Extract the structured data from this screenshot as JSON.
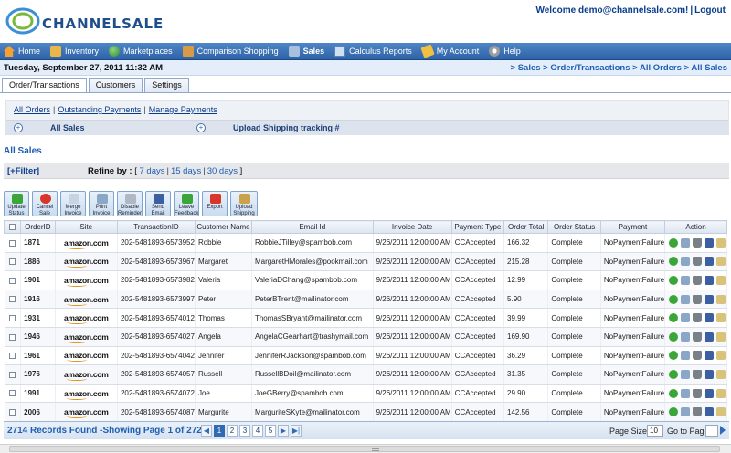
{
  "header": {
    "logo_text": "CHANNELSALE",
    "welcome": "Welcome demo@channelsale.com!",
    "separator": "|",
    "logout": "Logout"
  },
  "nav": {
    "items": [
      {
        "label": "Home",
        "icon": "home-icon"
      },
      {
        "label": "Inventory",
        "icon": "inventory-icon"
      },
      {
        "label": "Marketplaces",
        "icon": "globe-icon"
      },
      {
        "label": "Comparison Shopping",
        "icon": "folder-icon"
      },
      {
        "label": "Sales",
        "icon": "sales-icon"
      },
      {
        "label": "Calculus Reports",
        "icon": "chart-icon"
      },
      {
        "label": "My Account",
        "icon": "key-icon"
      },
      {
        "label": "Help",
        "icon": "help-icon"
      }
    ]
  },
  "datebar": {
    "date": "Tuesday, September 27, 2011 11:32 AM",
    "crumbs": [
      "Sales",
      "Order/Transactions",
      "All Orders",
      "All Sales"
    ]
  },
  "tabs": [
    "Order/Transactions",
    "Customers",
    "Settings"
  ],
  "subpanel": {
    "links": [
      "All Orders",
      "Outstanding Payments",
      "Manage Payments"
    ],
    "left_label": "All Sales",
    "right_label": "Upload Shipping tracking #"
  },
  "section_title": "All Sales",
  "filter": {
    "link": "[+Filter]",
    "refine_label": "Refine by :",
    "open_bracket": "[",
    "close_bracket": "]",
    "options": [
      "7 days",
      "15 days",
      "30 days"
    ]
  },
  "toolbar": [
    {
      "label": "Update Status",
      "icon": "update-status-icon",
      "color": "#3aa63a"
    },
    {
      "label": "Cancel Sale",
      "icon": "cancel-icon",
      "color": "#d9362b"
    },
    {
      "label": "Merge Invoice",
      "icon": "merge-icon",
      "color": "#c8d4e4"
    },
    {
      "label": "Print Invoice",
      "icon": "print-icon",
      "color": "#8aa7c7"
    },
    {
      "label": "Disable Reminder",
      "icon": "disable-reminder-icon",
      "color": "#b0b8c4"
    },
    {
      "label": "Send Email",
      "icon": "email-icon",
      "color": "#3b5fa0"
    },
    {
      "label": "Leave Feedback",
      "icon": "feedback-icon",
      "color": "#3aa63a"
    },
    {
      "label": "Export",
      "icon": "export-icon",
      "color": "#d9362b"
    },
    {
      "label": "Upload Shipping",
      "icon": "upload-shipping-icon",
      "color": "#c9a24a"
    }
  ],
  "table": {
    "columns": [
      "OrderID",
      "Site",
      "TransactionID",
      "Customer Name",
      "Email Id",
      "Invoice Date",
      "Payment Type",
      "Order Total",
      "Order Status",
      "Payment",
      "Action"
    ],
    "rows": [
      {
        "id": "1871",
        "site": "amazon.com",
        "txn": "202-5481893-6573952",
        "name": "Robbie",
        "email": "RobbieJTilley@spambob.com",
        "date": "9/26/2011 12:00:00 AM",
        "ptype": "CCAccepted",
        "total": "166.32",
        "status": "Complete",
        "payment": "NoPaymentFailure"
      },
      {
        "id": "1886",
        "site": "amazon.com",
        "txn": "202-5481893-6573967",
        "name": "Margaret",
        "email": "MargaretHMorales@pookmail.com",
        "date": "9/26/2011 12:00:00 AM",
        "ptype": "CCAccepted",
        "total": "215.28",
        "status": "Complete",
        "payment": "NoPaymentFailure"
      },
      {
        "id": "1901",
        "site": "amazon.com",
        "txn": "202-5481893-6573982",
        "name": "Valeria",
        "email": "ValeriaDChang@spambob.com",
        "date": "9/26/2011 12:00:00 AM",
        "ptype": "CCAccepted",
        "total": "12.99",
        "status": "Complete",
        "payment": "NoPaymentFailure"
      },
      {
        "id": "1916",
        "site": "amazon.com",
        "txn": "202-5481893-6573997",
        "name": "Peter",
        "email": "PeterBTrent@mailinator.com",
        "date": "9/26/2011 12:00:00 AM",
        "ptype": "CCAccepted",
        "total": "5.90",
        "status": "Complete",
        "payment": "NoPaymentFailure"
      },
      {
        "id": "1931",
        "site": "amazon.com",
        "txn": "202-5481893-6574012",
        "name": "Thomas",
        "email": "ThomasSBryant@mailinator.com",
        "date": "9/26/2011 12:00:00 AM",
        "ptype": "CCAccepted",
        "total": "39.99",
        "status": "Complete",
        "payment": "NoPaymentFailure"
      },
      {
        "id": "1946",
        "site": "amazon.com",
        "txn": "202-5481893-6574027",
        "name": "Angela",
        "email": "AngelaCGearhart@trashymail.com",
        "date": "9/26/2011 12:00:00 AM",
        "ptype": "CCAccepted",
        "total": "169.90",
        "status": "Complete",
        "payment": "NoPaymentFailure"
      },
      {
        "id": "1961",
        "site": "amazon.com",
        "txn": "202-5481893-6574042",
        "name": "Jennifer",
        "email": "JenniferRJackson@spambob.com",
        "date": "9/26/2011 12:00:00 AM",
        "ptype": "CCAccepted",
        "total": "36.29",
        "status": "Complete",
        "payment": "NoPaymentFailure"
      },
      {
        "id": "1976",
        "site": "amazon.com",
        "txn": "202-5481893-6574057",
        "name": "Russell",
        "email": "RussellBDoil@mailinator.com",
        "date": "9/26/2011 12:00:00 AM",
        "ptype": "CCAccepted",
        "total": "31.35",
        "status": "Complete",
        "payment": "NoPaymentFailure"
      },
      {
        "id": "1991",
        "site": "amazon.com",
        "txn": "202-5481893-6574072",
        "name": "Joe",
        "email": "JoeGBerry@spambob.com",
        "date": "9/26/2011 12:00:00 AM",
        "ptype": "CCAccepted",
        "total": "29.90",
        "status": "Complete",
        "payment": "NoPaymentFailure"
      },
      {
        "id": "2006",
        "site": "amazon.com",
        "txn": "202-5481893-6574087",
        "name": "Margurite",
        "email": "MarguriteSKyte@mailinator.com",
        "date": "9/26/2011 12:00:00 AM",
        "ptype": "CCAccepted",
        "total": "142.56",
        "status": "Complete",
        "payment": "NoPaymentFailure"
      }
    ]
  },
  "pager": {
    "records": "2714 Records Found -Showing Page 1 of 272",
    "pages": [
      "1",
      "2",
      "3",
      "4",
      "5"
    ],
    "current": "1",
    "page_size_label": "Page Size",
    "page_size": "10",
    "goto_label": "Go to Page"
  }
}
